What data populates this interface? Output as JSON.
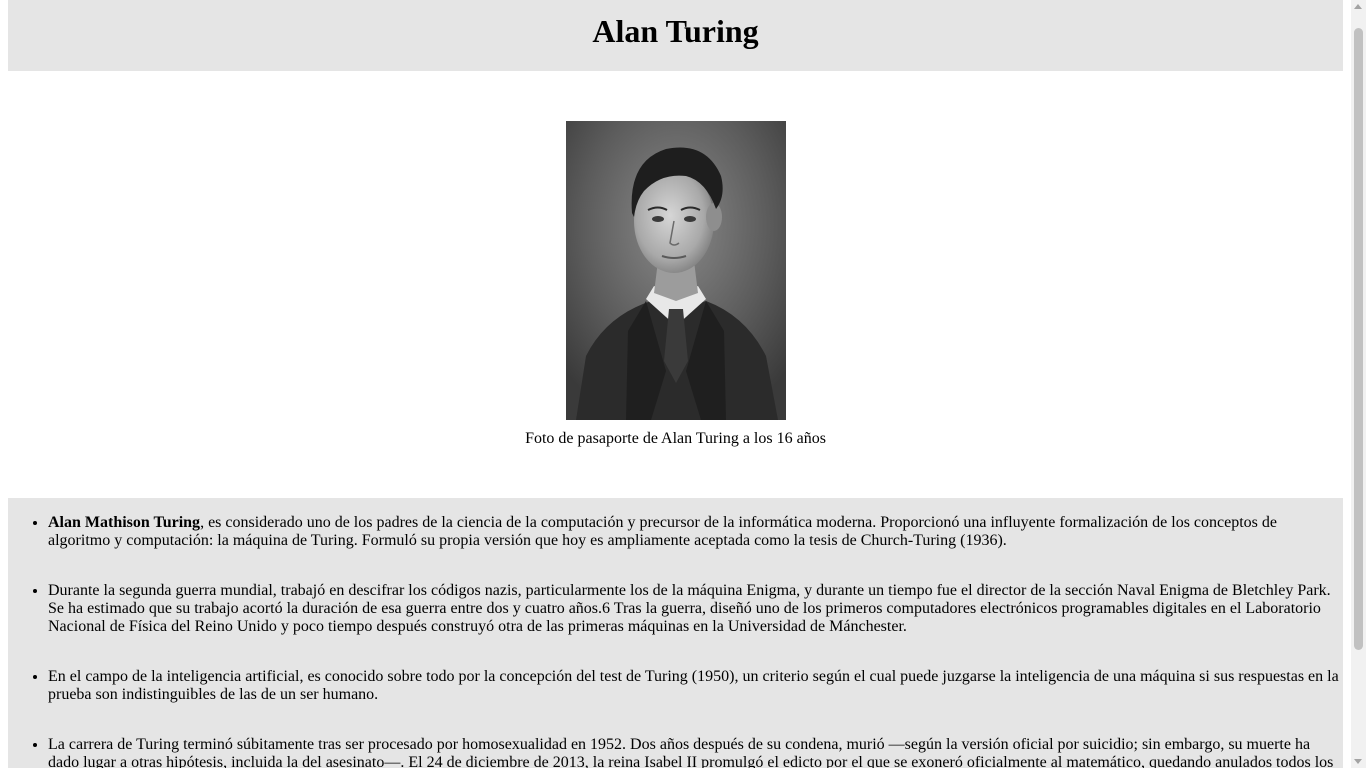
{
  "header": {
    "title": "Alan Turing"
  },
  "figure": {
    "caption": "Foto de pasaporte de Alan Turing a los 16 años"
  },
  "bio": {
    "items": [
      {
        "bold": "Alan Mathison Turing",
        "text": ", es considerado uno de los padres de la ciencia de la computación y precursor de la informática moderna. Proporcionó una influyente formalización de los conceptos de algoritmo y computación: la máquina de Turing. Formuló su propia versión que hoy es ampliamente aceptada como la tesis de Church-Turing (1936)."
      },
      {
        "bold": "",
        "text": "Durante la segunda guerra mundial, trabajó en descifrar los códigos nazis, particularmente los de la máquina Enigma, y durante un tiempo fue el director de la sección Naval Enigma de Bletchley Park. Se ha estimado que su trabajo acortó la duración de esa guerra entre dos y cuatro años.6 Tras la guerra, diseñó uno de los primeros computadores electrónicos programables digitales en el Laboratorio Nacional de Física del Reino Unido y poco tiempo después construyó otra de las primeras máquinas en la Universidad de Mánchester."
      },
      {
        "bold": "",
        "text": "En el campo de la inteligencia artificial, es conocido sobre todo por la concepción del test de Turing (1950), un criterio según el cual puede juzgarse la inteligencia de una máquina si sus respuestas en la prueba son indistinguibles de las de un ser humano."
      },
      {
        "bold": "",
        "text": "La carrera de Turing terminó súbitamente tras ser procesado por homosexualidad en 1952. Dos años después de su condena, murió —según la versión oficial por suicidio; sin embargo, su muerte ha dado lugar a otras hipótesis, incluida la del asesinato—. El 24 de diciembre de 2013, la reina Isabel II promulgó el edicto por el que se exoneró oficialmente al matemático, quedando anulados todos los cargos en su contra."
      }
    ]
  }
}
